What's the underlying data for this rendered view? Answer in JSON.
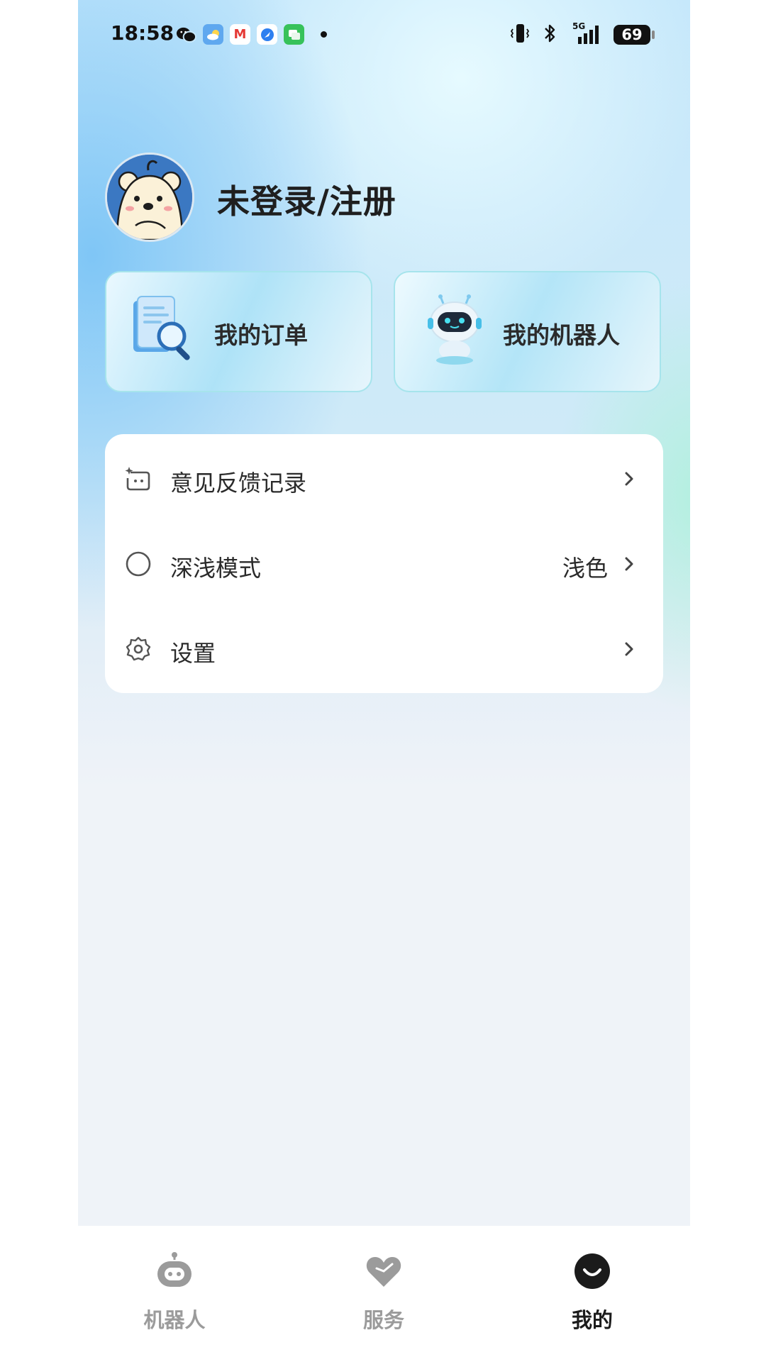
{
  "status_bar": {
    "time": "18:58",
    "battery": "69",
    "network": "5G"
  },
  "profile": {
    "login_label": "未登录/注册"
  },
  "quick_cards": [
    {
      "label": "我的订单",
      "icon": "order-search-icon"
    },
    {
      "label": "我的机器人",
      "icon": "robot-icon"
    }
  ],
  "menu": {
    "items": [
      {
        "label": "意见反馈记录",
        "icon": "feedback-icon",
        "value": ""
      },
      {
        "label": "深浅模式",
        "icon": "theme-mode-icon",
        "value": "浅色"
      },
      {
        "label": "设置",
        "icon": "gear-icon",
        "value": ""
      }
    ]
  },
  "tabbar": {
    "tabs": [
      {
        "label": "机器人",
        "icon": "robot-tab-icon",
        "active": false
      },
      {
        "label": "服务",
        "icon": "heart-icon",
        "active": false
      },
      {
        "label": "我的",
        "icon": "smile-icon",
        "active": true
      }
    ]
  },
  "colors": {
    "accent": "#1b1b1b",
    "inactive": "#9b9b9b",
    "card_border": "#a6e4ec"
  }
}
